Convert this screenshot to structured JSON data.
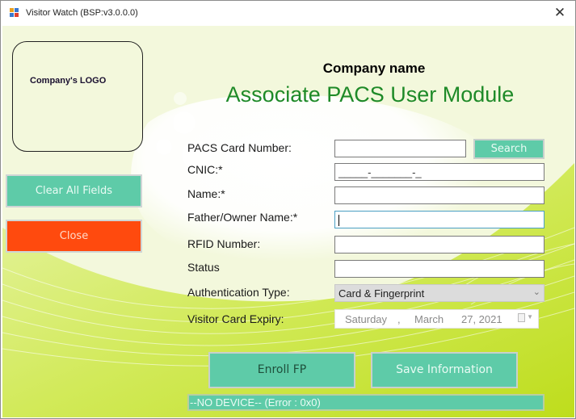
{
  "window": {
    "title": "Visitor Watch (BSP:v3.0.0.0)",
    "close_glyph": "✕",
    "icon": "app-window-icon"
  },
  "header": {
    "logo_placeholder": "Company's LOGO",
    "company_name": "Company name",
    "module_title": "Associate PACS User Module"
  },
  "side_buttons": {
    "clear_all": "Clear All Fields",
    "close": "Close"
  },
  "form": {
    "fields": [
      {
        "label": "PACS Card Number:",
        "value": ""
      },
      {
        "label": "CNIC:*",
        "value": "_____-_______-_"
      },
      {
        "label": "Name:*",
        "value": ""
      },
      {
        "label": "Father/Owner Name:*",
        "value": ""
      },
      {
        "label": "RFID Number:",
        "value": ""
      },
      {
        "label": "Status",
        "value": ""
      },
      {
        "label": "Authentication Type:",
        "value": "Card & Fingerprint"
      },
      {
        "label": "Visitor Card Expiry:",
        "value": ""
      }
    ],
    "search_label": "Search",
    "auth_type_selected": "Card & Fingerprint",
    "expiry": {
      "weekday": "Saturday",
      "sep": ",",
      "month": "March",
      "day_year": "27, 2021"
    }
  },
  "actions": {
    "enroll_fp": "Enroll FP",
    "save_information": "Save Information"
  },
  "status": {
    "text": "--NO DEVICE-- (Error : 0x0)"
  },
  "colors": {
    "accent_teal": "#5ecba8",
    "close_orange": "#ff4a0e",
    "title_green": "#1e8a28",
    "background_lime": "#c6e02a"
  }
}
